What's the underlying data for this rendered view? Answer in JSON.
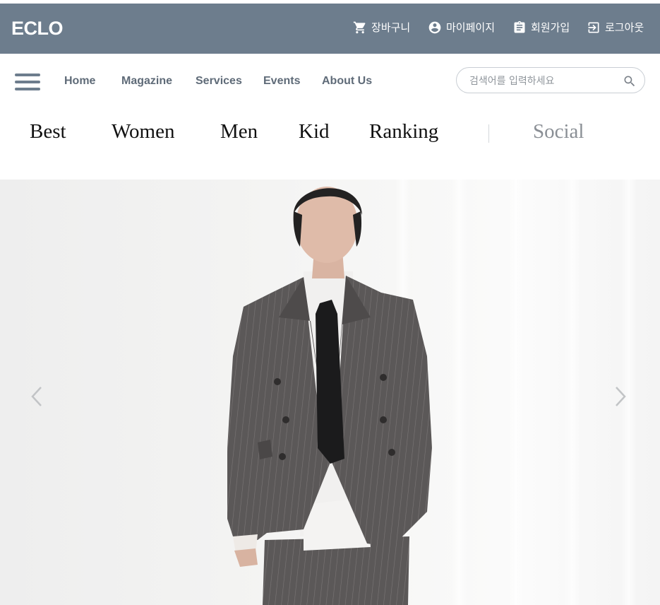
{
  "header": {
    "brand": "ECLO",
    "util_links": [
      {
        "label": "장바구니",
        "icon": "cart-icon"
      },
      {
        "label": "마이페이지",
        "icon": "user-circle-icon"
      },
      {
        "label": "회원가입",
        "icon": "clipboard-icon"
      },
      {
        "label": "로그아웃",
        "icon": "logout-icon"
      }
    ],
    "colors": {
      "bar": "#6d7d8d",
      "text": "#ffffff"
    }
  },
  "nav": {
    "menu_icon": "hamburger-icon",
    "links": [
      "Home",
      "Magazine",
      "Services",
      "Events",
      "About Us"
    ],
    "search": {
      "placeholder": "검색어를 입력하세요",
      "value": "",
      "icon": "search-icon"
    }
  },
  "categories": {
    "items": [
      "Best",
      "Women",
      "Men",
      "Kid",
      "Ranking"
    ],
    "secondary": "Social"
  },
  "hero": {
    "image": "man in grey pinstripe double-breasted suit with black tie",
    "prev_icon": "chevron-left-icon",
    "next_icon": "chevron-right-icon"
  }
}
